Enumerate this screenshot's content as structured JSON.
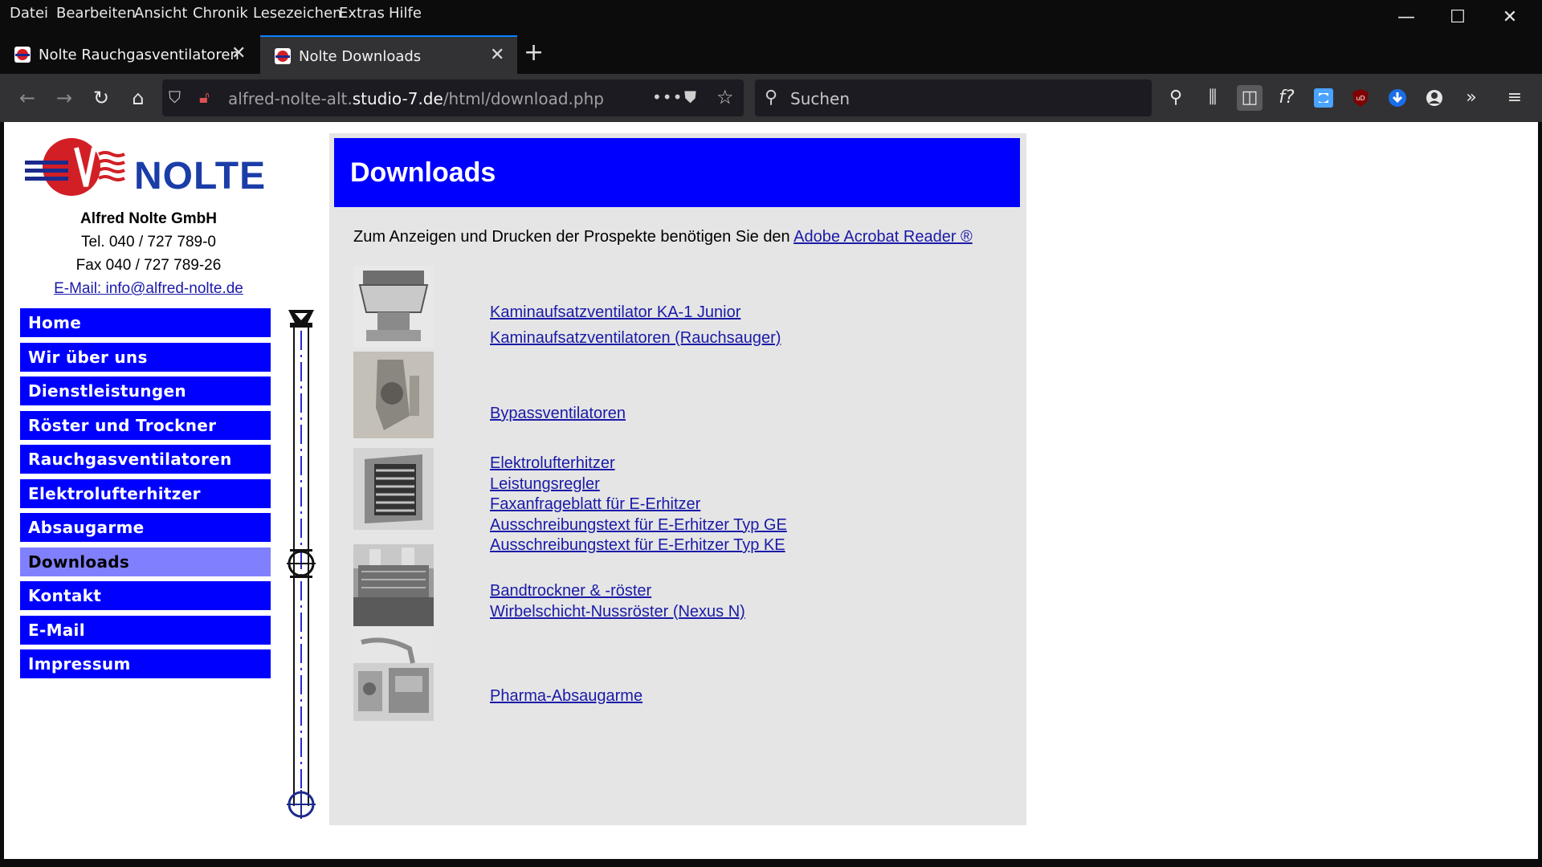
{
  "menubar": {
    "items": [
      "Datei",
      "Bearbeiten",
      "Ansicht",
      "Chronik",
      "Lesezeichen",
      "Extras",
      "Hilfe"
    ]
  },
  "window_controls": {
    "minimize": "—",
    "maximize": "☐",
    "close": "✕"
  },
  "tabs": [
    {
      "title": "Nolte Rauchgasventilatoren",
      "active": false
    },
    {
      "title": "Nolte Downloads",
      "active": true
    }
  ],
  "tab_close_glyph": "✕",
  "new_tab_glyph": "+",
  "navbar": {
    "url_prefix": "alfred-nolte-alt.",
    "url_host": "studio-7.de",
    "url_path": "/html/download.php",
    "page_actions_glyph": "•••",
    "search_placeholder": "Suchen"
  },
  "site": {
    "logo_text": "NOLTE",
    "company_name": "Alfred Nolte GmbH",
    "phone": "Tel. 040 / 727 789-0",
    "fax": "Fax 040 / 727 789-26",
    "email_link": "E-Mail: info@alfred-nolte.de",
    "nav": [
      {
        "label": "Home",
        "active": false
      },
      {
        "label": "Wir über uns",
        "active": false
      },
      {
        "label": "Dienstleistungen",
        "active": false
      },
      {
        "label": "Röster und Trockner",
        "active": false
      },
      {
        "label": "Rauchgasventilatoren",
        "active": false
      },
      {
        "label": "Elektrolufterhitzer",
        "active": false
      },
      {
        "label": "Absaugarme",
        "active": false
      },
      {
        "label": "Downloads",
        "active": true
      },
      {
        "label": "Kontakt",
        "active": false
      },
      {
        "label": "E-Mail",
        "active": false
      },
      {
        "label": "Impressum",
        "active": false
      }
    ]
  },
  "main": {
    "title": "Downloads",
    "intro_text": "Zum Anzeigen und Drucken der Prospekte benötigen Sie den ",
    "intro_link": "Adobe Acrobat Reader ®",
    "groups": [
      {
        "links": [
          "Kaminaufsatzventilator KA-1 Junior",
          "Kaminaufsatzventilatoren (Rauchsauger)"
        ]
      },
      {
        "links": [
          "Bypassventilatoren"
        ]
      },
      {
        "links": [
          "Elektrolufterhitzer",
          "Leistungsregler",
          "Faxanfrageblatt für E-Erhitzer",
          "Ausschreibungstext für E-Erhitzer Typ GE",
          "Ausschreibungstext für E-Erhitzer Typ KE"
        ]
      },
      {
        "links": [
          "Bandtrockner & -röster",
          "Wirbelschicht-Nussröster (Nexus N)"
        ]
      },
      {
        "links": [
          "Pharma-Absaugarme"
        ]
      }
    ]
  }
}
